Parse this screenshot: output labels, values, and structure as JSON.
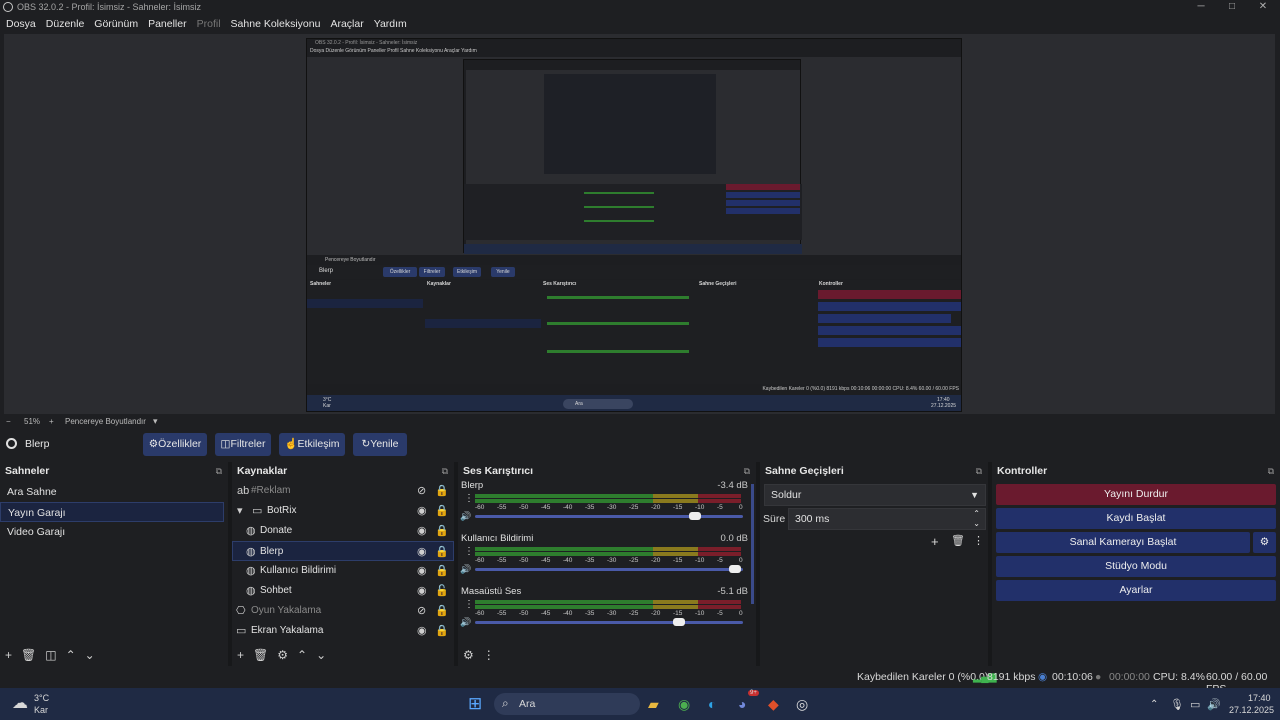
{
  "window": {
    "title": "OBS 32.0.2 - Profil: İsimsiz - Sahneler: İsimsiz",
    "minimize": "─",
    "maximize": "□",
    "close": "✕"
  },
  "menu": [
    "Dosya",
    "Düzenle",
    "Görünüm",
    "Paneller",
    "Profil",
    "Sahne Koleksiyonu",
    "Araçlar",
    "Yardım"
  ],
  "nested": {
    "title": "OBS 32.0.2 - Profil: İsimsiz - Sahneler: İsimsiz",
    "zoom": "Pencereye Boyutlandır",
    "current": "Blerp",
    "buttons": [
      "Özellikler",
      "Filtreler",
      "Etkileşim",
      "Yenile"
    ],
    "scenes_title": "Sahneler",
    "sources_title": "Kaynaklar",
    "mixer_title": "Ses Karıştırıcı",
    "trans_title": "Sahne Geçişleri",
    "controls_title": "Kontroller",
    "status": "Kaybedilen Kareler 0 (%0.0)   8191 kbps   00:10:06   00:00:00   CPU: 8.4%   60.00 / 60.00 FPS",
    "clock_time": "17:40",
    "clock_date": "27.12.2025",
    "temp": "3°C",
    "weather": "Kar",
    "search": "Ara"
  },
  "zoombar": {
    "minus": "−",
    "percent": "51%",
    "plus": "+",
    "fit": "Pencereye Boyutlandır",
    "arrow": "▾"
  },
  "toolbar": {
    "current_source": "Blerp",
    "properties": "Özellikler",
    "filters": "Filtreler",
    "interact": "Etkileşim",
    "refresh": "Yenile"
  },
  "scenes": {
    "title": "Sahneler",
    "items": [
      "Ara Sahne",
      "Yayın Garajı",
      "Video Garajı"
    ],
    "selected": 1
  },
  "sources": {
    "title": "Kaynaklar",
    "items": [
      {
        "label": "#Reklam",
        "indent": 0,
        "icon": "ab",
        "dim": true
      },
      {
        "label": "BotRix",
        "indent": 0,
        "icon": "folder",
        "dim": false
      },
      {
        "label": "Donate",
        "indent": 1,
        "icon": "browser",
        "dim": false
      },
      {
        "label": "Blerp",
        "indent": 1,
        "icon": "browser",
        "dim": false,
        "selected": true
      },
      {
        "label": "Kullanıcı Bildirimi",
        "indent": 1,
        "icon": "browser",
        "dim": false
      },
      {
        "label": "Sohbet",
        "indent": 1,
        "icon": "browser",
        "dim": false
      },
      {
        "label": "Oyun Yakalama",
        "indent": 0,
        "icon": "gamepad",
        "dim": true
      },
      {
        "label": "Ekran Yakalama",
        "indent": 0,
        "icon": "monitor",
        "dim": false
      }
    ]
  },
  "mixer": {
    "title": "Ses Karıştırıcı",
    "ticks": [
      "-60",
      "-55",
      "-50",
      "-45",
      "-40",
      "-35",
      "-30",
      "-25",
      "-20",
      "-15",
      "-10",
      "-5",
      "0"
    ],
    "channels": [
      {
        "name": "Blerp",
        "db": "-3.4 dB",
        "fader": 0.82
      },
      {
        "name": "Kullanıcı Bildirimi",
        "db": "0.0 dB",
        "fader": 0.97
      },
      {
        "name": "Masaüstü Ses",
        "db": "-5.1 dB",
        "fader": 0.76
      }
    ]
  },
  "transitions": {
    "title": "Sahne Geçişleri",
    "type": "Soldur",
    "duration_label": "Süre",
    "duration": "300 ms"
  },
  "controls": {
    "title": "Kontroller",
    "buttons": [
      "Yayını Durdur",
      "Kaydı Başlat",
      "Sanal Kamerayı Başlat",
      "Stüdyo Modu",
      "Ayarlar"
    ]
  },
  "status": {
    "dropped": "Kaybedilen Kareler 0 (%0.0)",
    "bitrate": "8191 kbps",
    "stream_time": "00:10:06",
    "rec_time": "00:00:00",
    "cpu": "CPU: 8.4%",
    "fps": "60.00 / 60.00 FPS"
  },
  "taskbar": {
    "temp": "3°C",
    "weather": "Kar",
    "search": "Ara",
    "time": "17:40",
    "date": "27.12.2025",
    "discord_badge": "9+"
  },
  "colors": {
    "accent": "#2a3a6a",
    "stop": "#6a1a2e",
    "meter_green": "#2e7d2e",
    "meter_yellow": "#8a7a1e",
    "meter_red": "#7a1e2a"
  }
}
